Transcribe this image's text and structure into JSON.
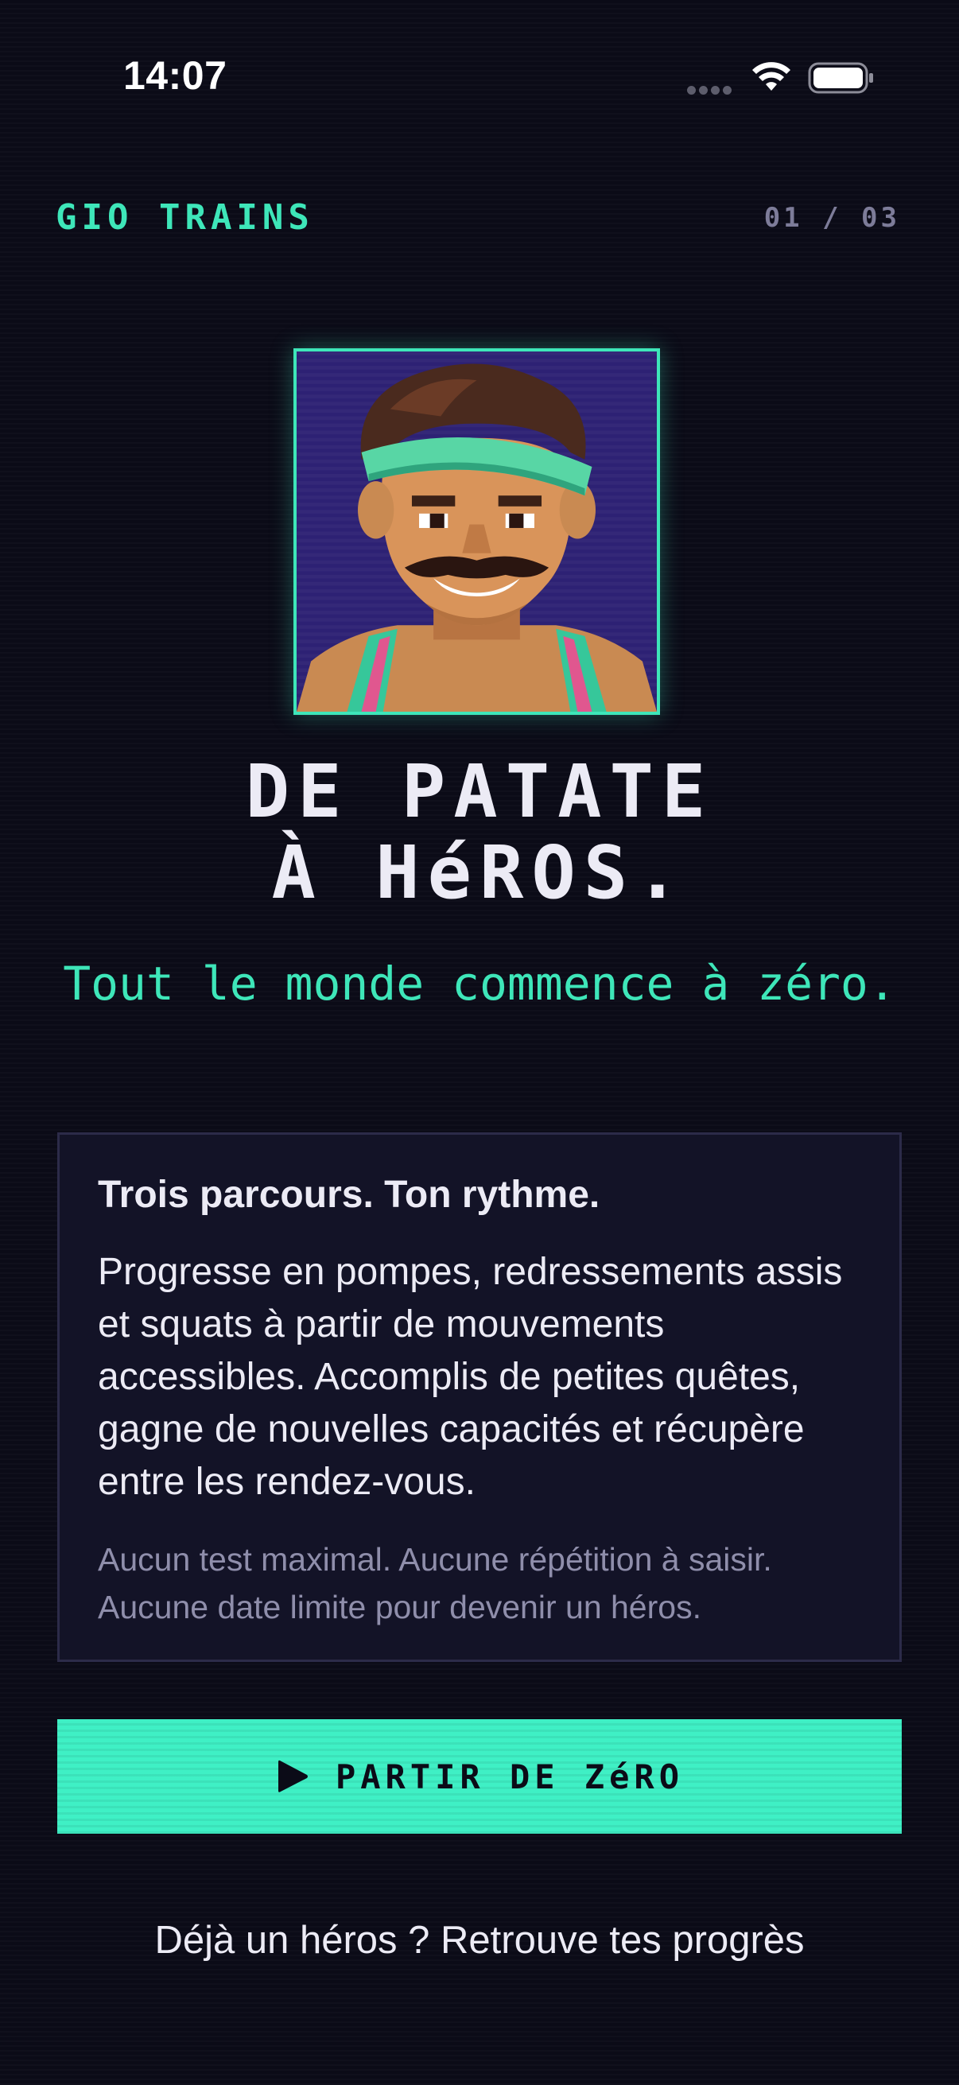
{
  "status_bar": {
    "time": "14:07"
  },
  "header": {
    "brand": "GIO TRAINS",
    "page_counter": "01 / 03"
  },
  "hero": {
    "title_line_1": "DE PATATE",
    "title_line_2": "À HéROS.",
    "tagline": "Tout le monde commence à zéro."
  },
  "card": {
    "heading": "Trois parcours. Ton rythme.",
    "body": "Progresse en pompes, redressements assis et squats à partir de mouvements accessibles. Accomplis de petites quêtes, gagne de nouvelles capacités et récupère entre les rendez-vous.",
    "note": "Aucun test maximal. Aucune répétition à saisir. Aucune date limite pour devenir un héros."
  },
  "cta": {
    "label": "PARTIR DE ZéRO",
    "icon": "play-icon"
  },
  "footer": {
    "signin_link": "Déjà un héros ? Retrouve tes progrès"
  },
  "colors": {
    "background": "#0b0b17",
    "accent": "#3ee6b9",
    "card_background": "#131327",
    "muted_text": "#8f8eab"
  }
}
